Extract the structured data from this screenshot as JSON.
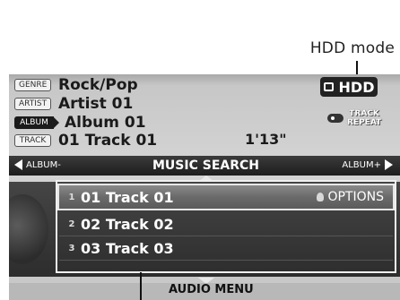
{
  "callout": {
    "label": "HDD mode"
  },
  "info": {
    "genre_tag": "GENRE",
    "genre": "Rock/Pop",
    "artist_tag": "ARTIST",
    "artist": "Artist 01",
    "album_tag": "ALBUM",
    "album": "Album 01",
    "track_tag": "TRACK",
    "track": "01 Track 01",
    "time": "1'13\""
  },
  "mode_badge": {
    "label": "HDD",
    "icon": "hdd-icon"
  },
  "track_repeat": {
    "line1": "TRACK",
    "line2": "REPEAT",
    "icon": "repeat-icon"
  },
  "nav": {
    "left": "ALBUM-",
    "title": "MUSIC SEARCH",
    "right": "ALBUM+"
  },
  "tracks": [
    {
      "num": "1",
      "title": "01 Track 01"
    },
    {
      "num": "2",
      "title": "02 Track 02"
    },
    {
      "num": "3",
      "title": "03 Track 03"
    }
  ],
  "options": {
    "label": "OPTIONS",
    "icon": "options-icon"
  },
  "bottom": {
    "label": "AUDIO MENU"
  }
}
